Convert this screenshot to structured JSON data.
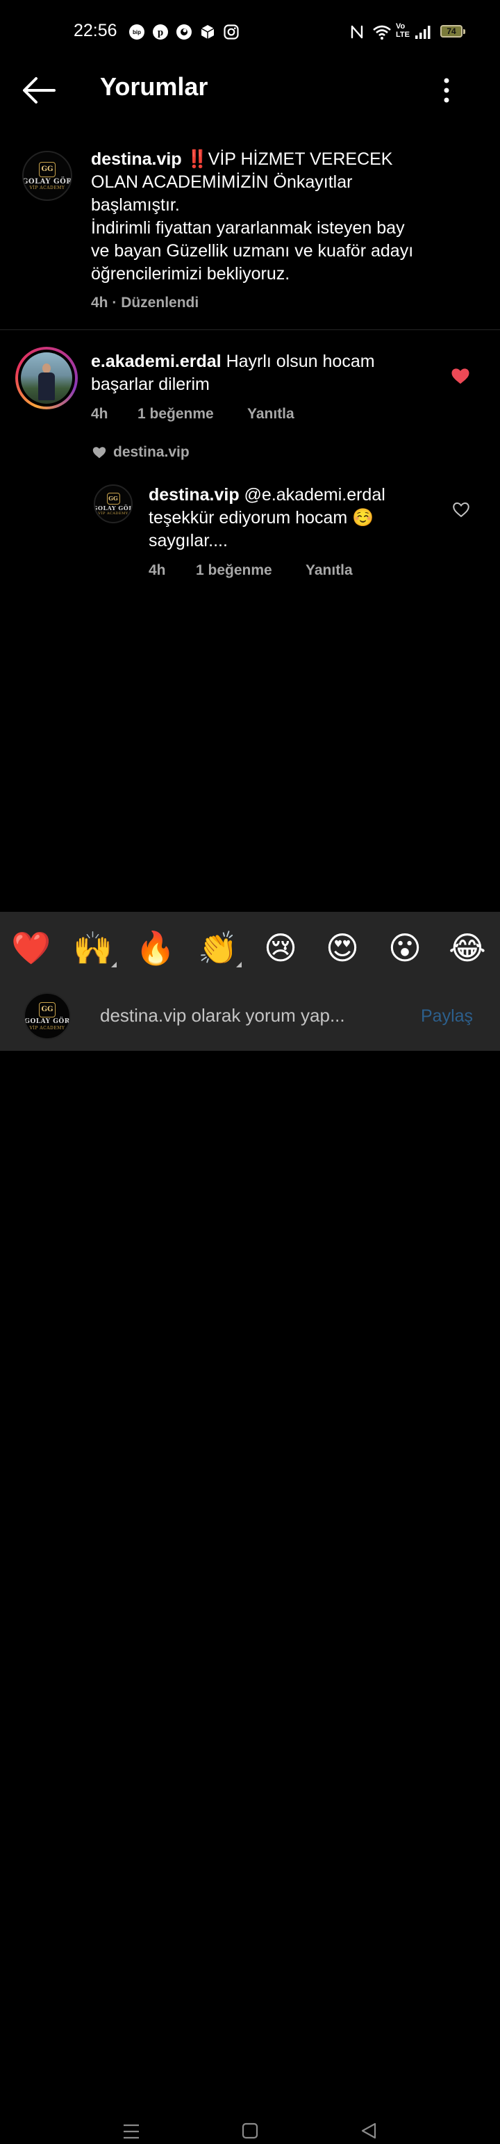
{
  "status_bar": {
    "time": "22:56",
    "battery": "74",
    "notification_icons": [
      "bip-icon",
      "pinterest-icon",
      "vodafone-icon",
      "box-app-icon",
      "instagram-icon"
    ],
    "system_icons": [
      "nfc-icon",
      "wifi-icon",
      "volte-icon",
      "signal-icon",
      "battery-icon"
    ],
    "volte_text_1": "Vo",
    "volte_text_2": "LTE"
  },
  "header": {
    "title": "Yorumlar"
  },
  "logo": {
    "mark": "GG",
    "text": "GOLAY GÖR",
    "sub": "VİP ACADEMY"
  },
  "caption": {
    "username": "destina.vip",
    "text_line1": " ‼️VİP HİZMET  VERECEK",
    "text_line2": "OLAN ACADEMİMİZİN Önkayıtlar",
    "text_line3": "başlamıştır.",
    "text_line4": "İndirimli fiyattan yararlanmak isteyen bay",
    "text_line5": "ve bayan Güzellik uzmanı  ve kuaför adayı",
    "text_line6": "öğrencilerimizi bekliyoruz.",
    "time": "4h",
    "separator": " · ",
    "edited": "Düzenlendi"
  },
  "comments": [
    {
      "username": "e.akademi.erdal",
      "text_line1": " Hayrlı olsun hocam",
      "text_line2": "başarlar dilerim",
      "time": "4h",
      "likes": "1 beğenme",
      "reply": "Yanıtla",
      "liked": true,
      "liked_by_author": "destina.vip"
    }
  ],
  "replies": [
    {
      "username": "destina.vip",
      "text_line1": " @e.akademi.erdal",
      "text_line2": "teşekkür ediyorum hocam ☺️",
      "text_line3": "saygılar....",
      "time": "4h",
      "likes": "1 beğenme",
      "reply": "Yanıtla",
      "liked": false
    }
  ],
  "emoji_bar": [
    "❤️",
    "🙌",
    "🔥",
    "👏",
    "😢",
    "😍",
    "😮",
    "😂"
  ],
  "comment_input": {
    "placeholder": "destina.vip olarak yorum yap...",
    "share_label": "Paylaş"
  },
  "colors": {
    "background": "#000000",
    "panel": "#262626",
    "like_red": "#ed4956",
    "share_blue": "#2c5f8c",
    "meta_gray": "#a8a8a8"
  }
}
